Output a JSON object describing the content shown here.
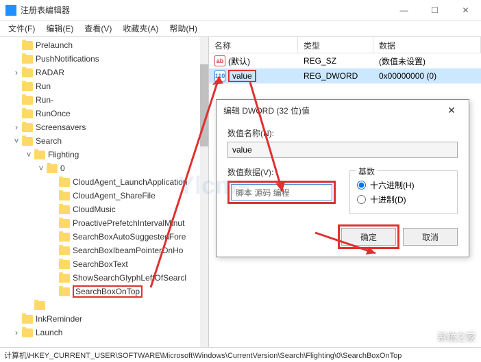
{
  "window": {
    "title": "注册表编辑器",
    "min": "—",
    "max": "☐",
    "close": "✕"
  },
  "menu": {
    "file": "文件(F)",
    "edit": "编辑(E)",
    "view": "查看(V)",
    "fav": "收藏夹(A)",
    "help": "帮助(H)"
  },
  "tree": {
    "items": [
      {
        "indent": 18,
        "exp": "",
        "label": "Prelaunch"
      },
      {
        "indent": 18,
        "exp": "",
        "label": "PushNotifications"
      },
      {
        "indent": 18,
        "exp": ">",
        "label": "RADAR"
      },
      {
        "indent": 18,
        "exp": "",
        "label": "Run"
      },
      {
        "indent": 18,
        "exp": "",
        "label": "Run-"
      },
      {
        "indent": 18,
        "exp": "",
        "label": "RunOnce"
      },
      {
        "indent": 18,
        "exp": ">",
        "label": "Screensavers"
      },
      {
        "indent": 18,
        "exp": "v",
        "label": "Search"
      },
      {
        "indent": 36,
        "exp": "v",
        "label": "Flighting"
      },
      {
        "indent": 54,
        "exp": "v",
        "label": "0"
      },
      {
        "indent": 72,
        "exp": "",
        "label": "CloudAgent_LaunchApplication"
      },
      {
        "indent": 72,
        "exp": "",
        "label": "CloudAgent_ShareFile"
      },
      {
        "indent": 72,
        "exp": "",
        "label": "CloudMusic"
      },
      {
        "indent": 72,
        "exp": "",
        "label": "ProactivePrefetchIntervalMinut"
      },
      {
        "indent": 72,
        "exp": "",
        "label": "SearchBoxAutoSuggestedFore"
      },
      {
        "indent": 72,
        "exp": "",
        "label": "SearchBoxIbeamPointerOnHo"
      },
      {
        "indent": 72,
        "exp": "",
        "label": "SearchBoxText"
      },
      {
        "indent": 72,
        "exp": "",
        "label": "ShowSearchGlyphLeftOfSearcl"
      },
      {
        "indent": 72,
        "exp": "",
        "label": "SearchBoxOnTop",
        "highlighted": true
      },
      {
        "indent": 36,
        "exp": "",
        "label": ""
      },
      {
        "indent": 18,
        "exp": "",
        "label": "InkReminder"
      },
      {
        "indent": 18,
        "exp": ">",
        "label": "Launch"
      }
    ]
  },
  "list": {
    "headers": {
      "name": "名称",
      "type": "类型",
      "data": "数据"
    },
    "rows": [
      {
        "icon": "ab",
        "name": "(默认)",
        "type": "REG_SZ",
        "data": "(数值未设置)"
      },
      {
        "icon": "110",
        "name": "value",
        "type": "REG_DWORD",
        "data": "0x00000000 (0)",
        "selected": true,
        "nameBox": true
      }
    ]
  },
  "dialog": {
    "title": "编辑 DWORD (32 位)值",
    "nameLabel": "数值名称(N):",
    "nameValue": "value",
    "dataLabel": "数值数据(V):",
    "dataValue": "脚本 源码 编程",
    "radixLabel": "基数",
    "hexLabel": "十六进制(H)",
    "decLabel": "十进制(D)",
    "ok": "确定",
    "cancel": "取消"
  },
  "statusbar": "计算机\\HKEY_CURRENT_USER\\SOFTWARE\\Microsoft\\Windows\\CurrentVersion\\Search\\Flighting\\0\\SearchBoxOnTop",
  "watermark": "Ylcms",
  "corner": "系统之家"
}
